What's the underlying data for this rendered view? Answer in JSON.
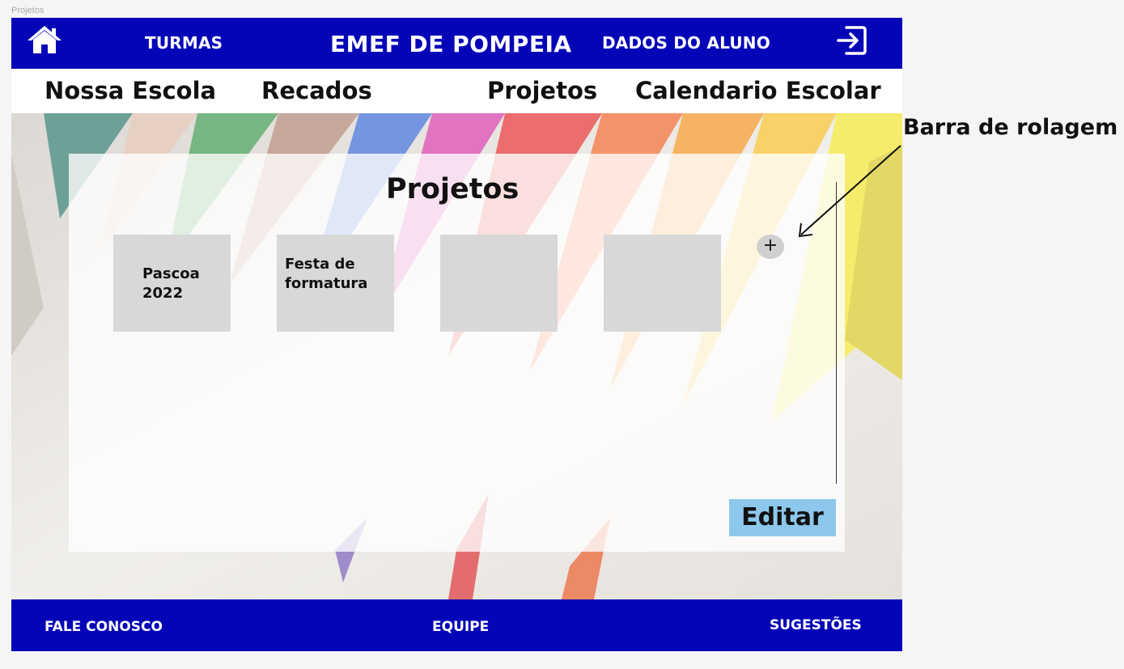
{
  "frame": {
    "label": "Projetos"
  },
  "header": {
    "home_icon": "home-icon",
    "turmas_label": "TURMAS",
    "brand_title": "EMEF DE POMPEIA",
    "dados_label": "DADOS DO ALUNO",
    "logout_icon": "logout-icon"
  },
  "menu": {
    "items": [
      {
        "label": "Nossa Escola"
      },
      {
        "label": "Recados"
      },
      {
        "label": "Projetos"
      },
      {
        "label": "Calendario Escolar"
      }
    ]
  },
  "panel": {
    "title": "Projetos",
    "cards": [
      {
        "title_line1": "Pascoa",
        "title_line2": "2022"
      },
      {
        "title_line1": "Festa de",
        "title_line2": "formatura"
      },
      {
        "title_line1": "",
        "title_line2": ""
      },
      {
        "title_line1": "",
        "title_line2": ""
      }
    ],
    "add_label": "+",
    "edit_label": "Editar"
  },
  "footer": {
    "contact_label": "FALE CONOSCO",
    "team_label": "EQUIPE",
    "suggestions_label": "SUGESTÕES"
  },
  "annotation": {
    "text": "Barra de rolagem"
  },
  "colors": {
    "brand_blue": "#0505b8",
    "edit_button": "#8dc8ec",
    "card_gray": "#d8d8d8"
  }
}
